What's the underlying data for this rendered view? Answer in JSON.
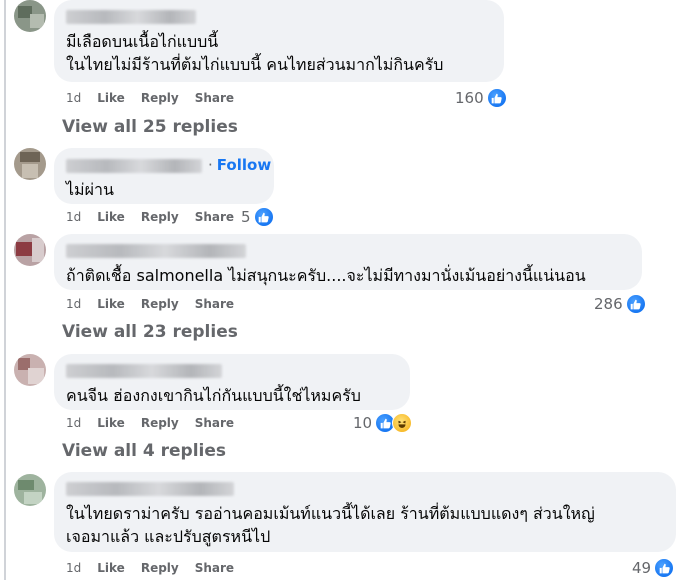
{
  "comments": [
    {
      "text_lines": [
        "มีเลือดบนเนื้อไก่แบบนี้",
        "ในไทยไม่มีร้านที่ต้มไก่แบบนี้ คนไทยส่วนมากไม่กินครับ"
      ],
      "time": "1d",
      "like": "Like",
      "reply": "Reply",
      "share": "Share",
      "reaction_count": "160",
      "reactions": [
        "like-icon"
      ],
      "view_replies": "View all 25 replies"
    },
    {
      "follow": "Follow",
      "text_lines": [
        "ไม่ผ่าน"
      ],
      "time": "1d",
      "like": "Like",
      "reply": "Reply",
      "share": "Share",
      "reaction_count": "5",
      "reactions": [
        "like-icon"
      ]
    },
    {
      "text_lines": [
        "ถ้าติดเชื้อ salmonella ไม่สนุกนะครับ....จะไม่มีทางมานั่งเม้นอย่างนี้แน่นอน"
      ],
      "time": "1d",
      "like": "Like",
      "reply": "Reply",
      "share": "Share",
      "reaction_count": "286",
      "reactions": [
        "like-icon"
      ],
      "view_replies": "View all 23 replies"
    },
    {
      "text_lines": [
        "คนจีน ฮ่องกงเขากินไก่กันแบบนี้ใช่ไหมครับ"
      ],
      "time": "1d",
      "like": "Like",
      "reply": "Reply",
      "share": "Share",
      "reaction_count": "10",
      "reactions": [
        "like-icon",
        "haha-icon"
      ],
      "view_replies": "View all 4 replies"
    },
    {
      "text_lines": [
        "ในไทยดราม่าครับ รออ่านคอมเม้นท์แนวนี้ได้เลย ร้านที่ต้มแบบแดงๆ ส่วนใหญ่",
        "เจอมาแล้ว และปรับสูตรหนีไป"
      ],
      "time": "1d",
      "like": "Like",
      "reply": "Reply",
      "share": "Share",
      "reaction_count": "49",
      "reactions": [
        "like-icon"
      ]
    }
  ],
  "colors": {
    "accent": "#1877f2",
    "bubble": "#f0f2f5",
    "meta": "#65676b"
  }
}
